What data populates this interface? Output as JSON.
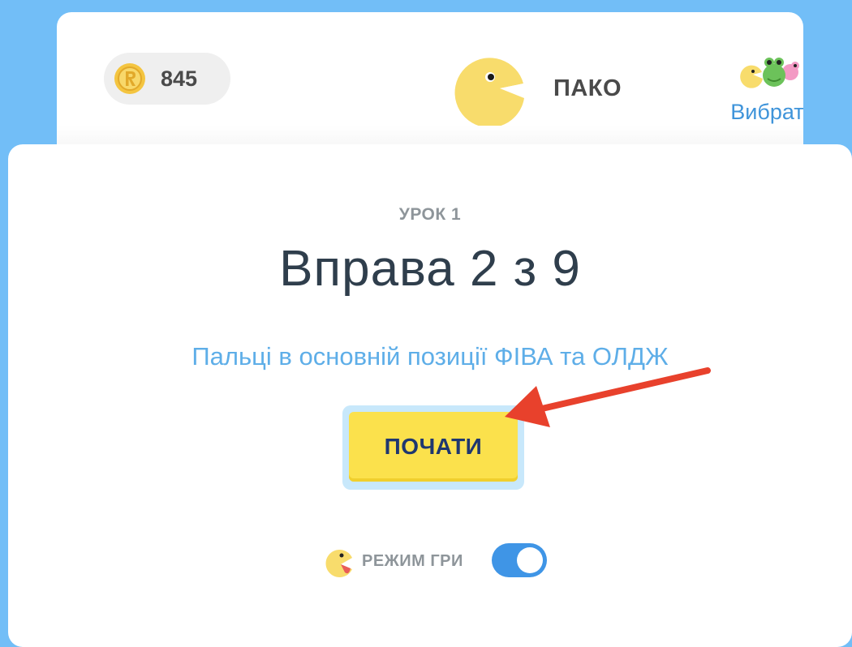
{
  "header": {
    "coins": "845",
    "hero_name": "ПАКО",
    "choose_label": "Вибрати"
  },
  "lesson": {
    "label": "УРОК 1",
    "title": "Вправа 2 з 9",
    "subtitle": "Пальці в основній позиції ФІВА та ОЛДЖ"
  },
  "start_button": {
    "label": "ПОЧАТИ"
  },
  "game_mode": {
    "label": "РЕЖИМ ГРИ",
    "enabled": true
  },
  "icons": {
    "coin": "coin-icon",
    "hero": "pacman-avatar-icon",
    "choose": "characters-group-icon",
    "game_mode": "pacman-tongue-icon",
    "annotation": "red-arrow-icon"
  },
  "colors": {
    "background": "#72bef7",
    "title": "#2f3e4c",
    "subtitle": "#5eaee8",
    "button": "#fbe14c",
    "button_text": "#1f3770",
    "toggle_on": "#3f95e6",
    "arrow": "#e8412c"
  }
}
